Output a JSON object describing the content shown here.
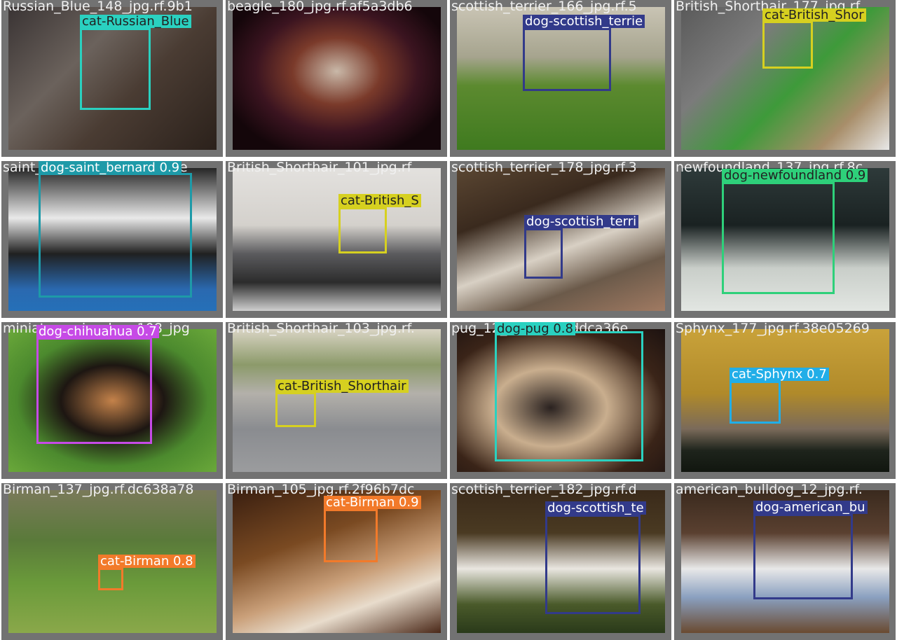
{
  "tiles": [
    {
      "file": "Russian_Blue_148_jpg.rf.9b1",
      "label": "cat-Russian_Blue",
      "color": "#2ad1c0",
      "dark": true,
      "bg": "linear-gradient(135deg,#3a3434 0%,#6b625c 35%,#4a3c33 60%,#2b211b 100%)"
    },
    {
      "file": "beagle_180_jpg.rf.af5a3db6",
      "label": "",
      "color": "",
      "bg": "radial-gradient(ellipse at 50% 45%,#c9b8a8 0%,#7a3a2a 30%,#3b1420 55%,#14060a 80%)"
    },
    {
      "file": "scottish_terrier_166_jpg.rf.5",
      "label": "dog-scottish_terrie",
      "color": "#323a8a",
      "dark": false,
      "bg": "linear-gradient(180deg,#c9c4b4 0%,#a6a48e 35%,#5c8a2f 55%,#3f7a1f 100%)"
    },
    {
      "file": "British_Shorthair_177_jpg.rf",
      "label": "cat-British_Shor",
      "color": "#d6d020",
      "dark": true,
      "bg": "linear-gradient(135deg,#5a5a5a 0%,#7b7b7b 30%,#3e9a3a 55%,#a88e6a 80%,#e8e8e8 100%)"
    },
    {
      "file": "saint_bernard_15_jpg.rf.e3e",
      "label": "dog-saint_bernard 0.9",
      "color": "#1e9aa8",
      "dark": false,
      "bg": "linear-gradient(180deg,#262626 0%,#e9e9e9 35%,#202020 60%,#2a69b0 85%,#2570b8 100%)"
    },
    {
      "file": "British_Shorthair_101_jpg.rf",
      "label": "cat-British_S",
      "color": "#d6d020",
      "dark": true,
      "bg": "linear-gradient(180deg,#e3e1de 0%,#d4d1cc 40%,#5b5b5e 60%,#2c2c2c 80%,#cfcfcf 100%)"
    },
    {
      "file": "scottish_terrier_178_jpg.rf.3",
      "label": "dog-scottish_terri",
      "color": "#323a8a",
      "dark": false,
      "bg": "linear-gradient(160deg,#5a4632 0%,#3a2a1e 30%,#d8d0c4 55%,#6b5a4a 75%,#a07a62 100%)"
    },
    {
      "file": "newfoundland_137_jpg.rf.8c",
      "label": "dog-newfoundland 0.9",
      "color": "#2ed07a",
      "dark": true,
      "bg": "linear-gradient(180deg,#2e3a3a 0%,#1a2222 40%,#c9cec9 70%,#e2e6e2 100%)"
    },
    {
      "file": "miniature_pinscher_108_jpg",
      "label": "dog-chihuahua 0.7",
      "color": "#c64ae6",
      "dark": false,
      "bg": "radial-gradient(ellipse at 50% 50%,#c4824a 0%,#1d1612 35%,#4c8a2e 65%,#6aa83a 100%)"
    },
    {
      "file": "British_Shorthair_103_jpg.rf.",
      "label": "cat-British_Shorthair",
      "color": "#d6d020",
      "dark": true,
      "bg": "linear-gradient(180deg,#d9d4c4 0%,#8c9a6a 25%,#b3b0aa 45%,#8a8c90 70%,#9b9c9e 100%)"
    },
    {
      "file": "pug_12_jpg.rf.b56ddca36e",
      "label": "dog-pug 0.8",
      "color": "#2ad1c0",
      "dark": true,
      "bg": "radial-gradient(ellipse at 45% 55%,#2a2220 0%,#c9ae8e 35%,#3a2418 70%,#1c1210 100%)"
    },
    {
      "file": "Sphynx_177_jpg.rf.38e05269",
      "label": "cat-Sphynx 0.7",
      "color": "#21aee8",
      "dark": false,
      "bg": "linear-gradient(180deg,#c9a23a 0%,#b08a2a 45%,#7a6a5a 70%,#1e241c 85%,#11160f 100%)"
    },
    {
      "file": "Birman_137_jpg.rf.dc638a78",
      "label": "cat-Birman 0.8",
      "color": "#f27a2a",
      "dark": false,
      "bg": "linear-gradient(180deg,#7a7a5a 0%,#5a7a3a 35%,#6a9a3a 65%,#8aa84a 100%)"
    },
    {
      "file": "Birman_105_jpg.rf.2f96b7dc",
      "label": "cat-Birman 0.9",
      "color": "#f27a2a",
      "dark": false,
      "bg": "linear-gradient(160deg,#3a1f10 0%,#7a4a22 35%,#caa07a 60%,#e8dccc 75%,#4a2818 100%)"
    },
    {
      "file": "scottish_terrier_182_jpg.rf.d",
      "label": "dog-scottish_te",
      "color": "#323a8a",
      "dark": false,
      "bg": "linear-gradient(180deg,#3a2a1a 0%,#4a3a22 30%,#e9e6e0 55%,#4a5a2a 80%,#2a3a1a 100%)"
    },
    {
      "file": "american_bulldog_12_jpg.rf.",
      "label": "dog-american_bu",
      "color": "#323a8a",
      "dark": false,
      "bg": "linear-gradient(180deg,#3a2a1e 0%,#5a4030 30%,#e8e8e8 55%,#8aa0c0 75%,#6a4a30 100%)"
    }
  ]
}
